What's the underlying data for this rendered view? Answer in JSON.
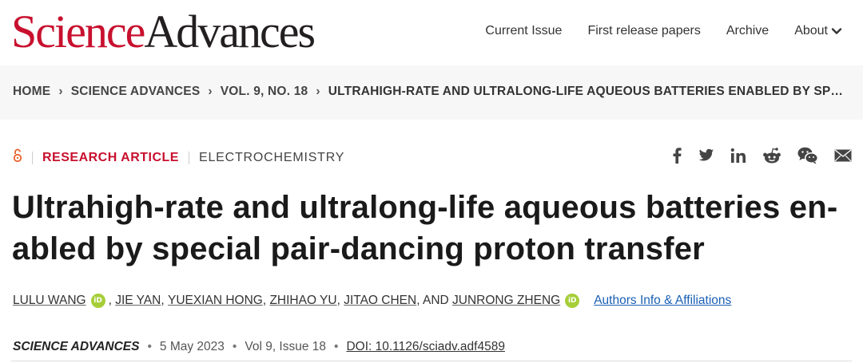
{
  "header": {
    "logo_science": "Science",
    "logo_advances": "Advances",
    "nav": [
      "Current Issue",
      "First release papers",
      "Archive"
    ],
    "about_label": "About"
  },
  "breadcrumb": {
    "items": [
      "HOME",
      "SCIENCE ADVANCES",
      "VOL. 9, NO. 18",
      "ULTRAHIGH-RATE AND ULTRALONG-LIFE AQUEOUS BATTERIES ENABLED BY SPECIAL PAIR-DANCING PROTON TRANSFER"
    ]
  },
  "article": {
    "open_access_icon": "open-access-icon",
    "type": "RESEARCH ARTICLE",
    "subject": "ELECTROCHEMISTRY",
    "title": "Ultrahigh-rate and ultralong-life aqueous batteries en-abled by special pair-dancing proton transfer",
    "authors": [
      "LULU WANG",
      "JIE YAN",
      "YUEXIAN HONG",
      "ZHIHAO YU",
      "JITAO CHEN",
      "JUNRONG ZHENG"
    ],
    "and_text": ", AND",
    "orcid_label": "iD",
    "affiliations_link": "Authors Info & Affiliations",
    "journal": "SCIENCE ADVANCES",
    "date": "5 May 2023",
    "volume": "Vol 9, Issue 18",
    "doi": "DOI: 10.1126/sciadv.adf4589"
  },
  "share_icons": [
    "facebook-icon",
    "twitter-icon",
    "linkedin-icon",
    "reddit-icon",
    "wechat-icon",
    "email-icon"
  ],
  "colors": {
    "brand_red": "#c8102e",
    "open_access": "#e8602c",
    "orcid_green": "#a6ce39",
    "link_blue": "#1a5fb4"
  }
}
